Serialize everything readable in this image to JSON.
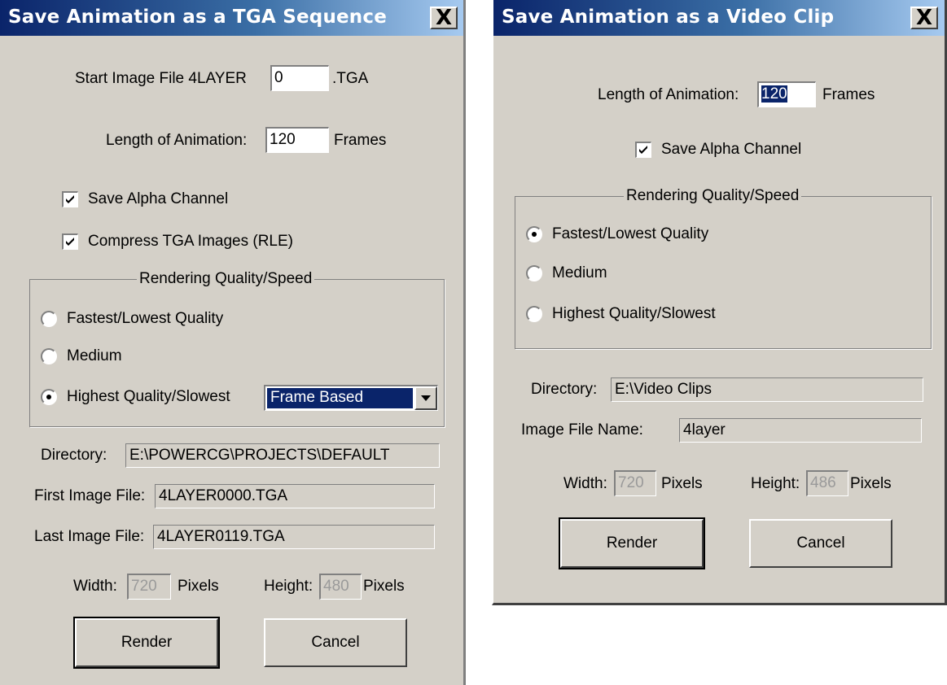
{
  "tga_dialog": {
    "title": "Save Animation as a TGA Sequence",
    "close_glyph": "X",
    "start_label": "Start Image File 4LAYER",
    "start_value": "0",
    "start_suffix": ".TGA",
    "length_label": "Length of Animation:",
    "length_value": "120",
    "length_unit": "Frames",
    "alpha_label": "Save Alpha Channel",
    "alpha_checked": true,
    "compress_label": "Compress TGA Images (RLE)",
    "compress_checked": true,
    "quality_group": "Rendering Quality/Speed",
    "quality_options": [
      "Fastest/Lowest Quality",
      "Medium",
      "Highest Quality/Slowest"
    ],
    "quality_selected": "Highest Quality/Slowest",
    "field_mode": "Frame Based",
    "directory_label": "Directory:",
    "directory_value": "E:\\POWERCG\\PROJECTS\\DEFAULT",
    "first_label": "First Image File:",
    "first_value": "4LAYER0000.TGA",
    "last_label": "Last Image File:",
    "last_value": "4LAYER0119.TGA",
    "width_label": "Width:",
    "width_value": "720",
    "height_label": "Height:",
    "height_value": "480",
    "pixels_label": "Pixels",
    "render_label": "Render",
    "cancel_label": "Cancel"
  },
  "video_dialog": {
    "title": "Save Animation as a Video Clip",
    "close_glyph": "X",
    "length_label": "Length of Animation:",
    "length_value": "120",
    "length_unit": "Frames",
    "alpha_label": "Save Alpha Channel",
    "alpha_checked": true,
    "quality_group": "Rendering Quality/Speed",
    "quality_options": [
      "Fastest/Lowest Quality",
      "Medium",
      "Highest Quality/Slowest"
    ],
    "quality_selected": "Fastest/Lowest Quality",
    "directory_label": "Directory:",
    "directory_value": "E:\\Video Clips",
    "filename_label": "Image File Name:",
    "filename_value": "4layer",
    "width_label": "Width:",
    "width_value": "720",
    "height_label": "Height:",
    "height_value": "486",
    "pixels_label": "Pixels",
    "render_label": "Render",
    "cancel_label": "Cancel"
  },
  "icons": [
    "close-icon",
    "checkmark-icon",
    "radio-dot-icon",
    "dropdown-arrow-icon"
  ],
  "colors": {
    "titlebar": "#0a246a",
    "face": "#d4d0c8",
    "selection": "#0a246a"
  }
}
